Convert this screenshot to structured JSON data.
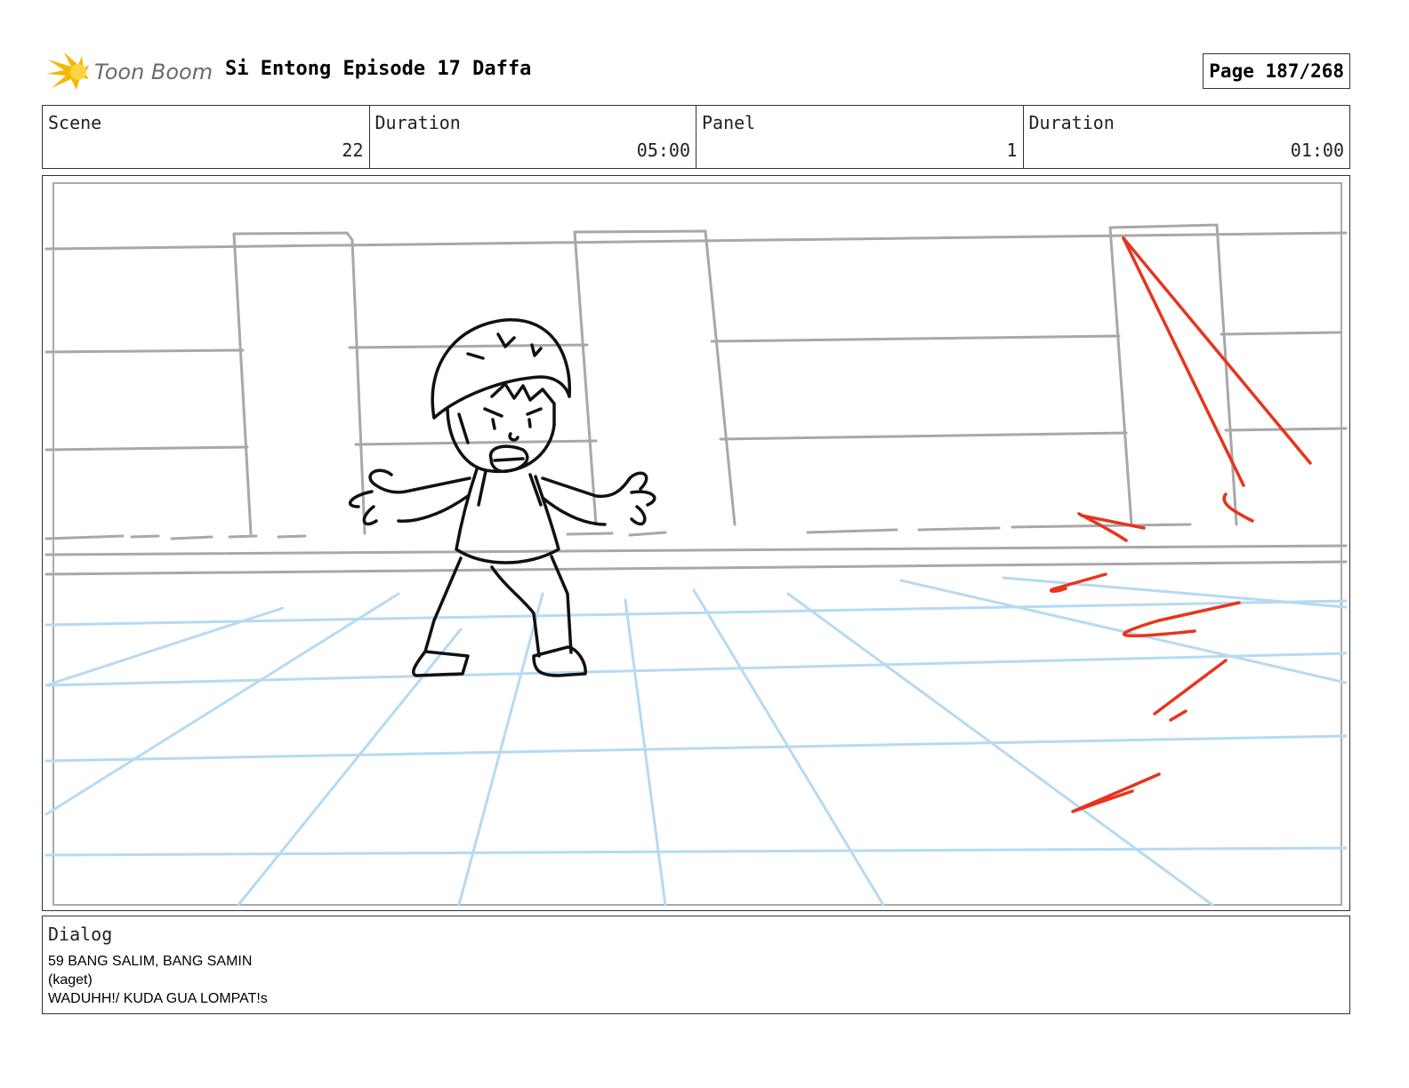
{
  "header": {
    "logo_text": "Toon Boom",
    "title": "Si Entong Episode 17 Daffa",
    "page": "Page 187/268"
  },
  "info": {
    "scene_label": "Scene",
    "scene_value": "22",
    "duration_label": "Duration",
    "duration_value": "05:00",
    "panel_label": "Panel",
    "panel_value": "1",
    "panel_duration_label": "Duration",
    "panel_duration_value": "01:00"
  },
  "dialog": {
    "label": "Dialog",
    "lines": [
      "59 BANG SALIM, BANG SAMIN",
      "(kaget)",
      "WADUHH!/ KUDA GUA LOMPAT!s"
    ]
  },
  "colors": {
    "sketch_gray": "#a8a8a8",
    "grid_blue": "#b6daf2",
    "action_red": "#e8341c",
    "logo_yellow": "#f5b800"
  }
}
